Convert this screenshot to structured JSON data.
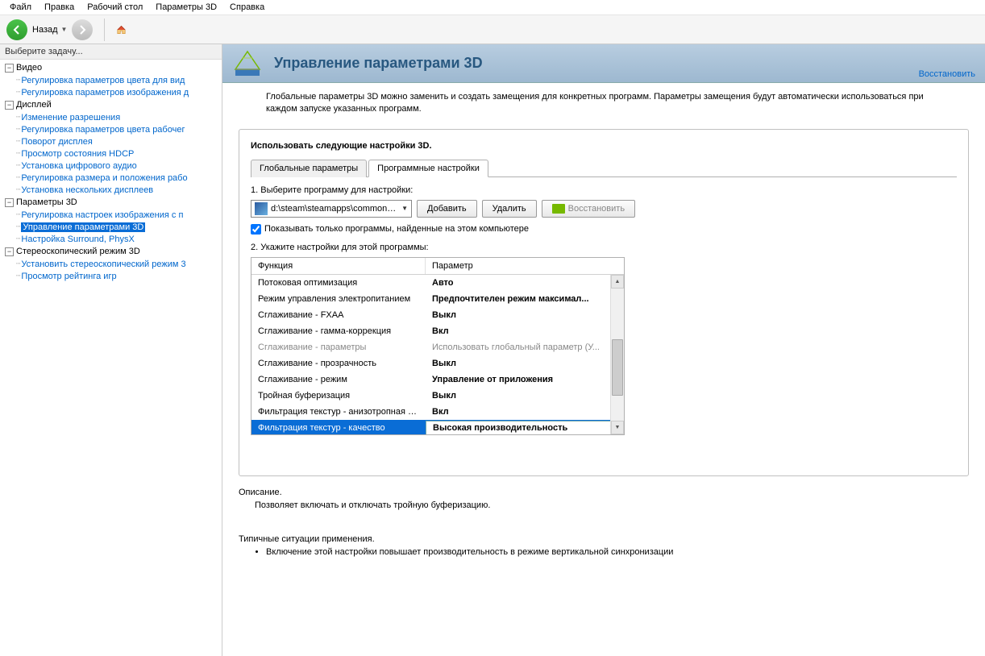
{
  "menubar": [
    "Файл",
    "Правка",
    "Рабочий стол",
    "Параметры 3D",
    "Справка"
  ],
  "toolbar": {
    "back": "Назад"
  },
  "sidebar": {
    "title": "Выберите задачу...",
    "groups": [
      {
        "label": "Видео",
        "items": [
          "Регулировка параметров цвета для вид",
          "Регулировка параметров изображения д"
        ]
      },
      {
        "label": "Дисплей",
        "items": [
          "Изменение разрешения",
          "Регулировка параметров цвета рабочег",
          "Поворот дисплея",
          "Просмотр состояния HDCP",
          "Установка цифрового аудио",
          "Регулировка размера и положения рабо",
          "Установка нескольких дисплеев"
        ]
      },
      {
        "label": "Параметры 3D",
        "items": [
          "Регулировка настроек изображения с п",
          "Управление параметрами 3D",
          "Настройка Surround, PhysX"
        ],
        "selected": 1
      },
      {
        "label": "Стереоскопический режим 3D",
        "items": [
          "Установить стереоскопический режим 3",
          "Просмотр рейтинга игр"
        ]
      }
    ]
  },
  "banner": {
    "title": "Управление параметрами 3D",
    "restore": "Восстановить"
  },
  "intro": "Глобальные параметры 3D можно заменить и создать замещения для конкретных программ. Параметры замещения будут автоматически использоваться при каждом запуске указанных программ.",
  "panel": {
    "heading": "Использовать следующие настройки 3D.",
    "tabs": [
      "Глобальные параметры",
      "Программные настройки"
    ],
    "active_tab": 1,
    "step1": "1. Выберите программу для настройки:",
    "program": "d:\\steam\\steamapps\\common\\r...",
    "btn_add": "Добавить",
    "btn_del": "Удалить",
    "btn_restore": "Восстановить",
    "checkbox": "Показывать только программы, найденные на этом компьютере",
    "step2": "2. Укажите настройки для этой программы:",
    "cols": {
      "func": "Функция",
      "param": "Параметр"
    },
    "rows": [
      {
        "func": "Потоковая оптимизация",
        "param": "Авто"
      },
      {
        "func": "Режим управления электропитанием",
        "param": "Предпочтителен режим максимал..."
      },
      {
        "func": "Сглаживание - FXAA",
        "param": "Выкл"
      },
      {
        "func": "Сглаживание - гамма-коррекция",
        "param": "Вкл"
      },
      {
        "func": "Сглаживание - параметры",
        "param": "Использовать глобальный параметр (У...",
        "disabled": true
      },
      {
        "func": "Сглаживание - прозрачность",
        "param": "Выкл"
      },
      {
        "func": "Сглаживание - режим",
        "param": "Управление от приложения"
      },
      {
        "func": "Тройная буферизация",
        "param": "Выкл"
      },
      {
        "func": "Фильтрация текстур - анизотропная оп...",
        "param": "Вкл"
      },
      {
        "func": "Фильтрация текстур - качество",
        "param": "Высокая производительность",
        "selected": true
      }
    ]
  },
  "description": {
    "heading": "Описание.",
    "body": "Позволяет включать и отключать тройную буферизацию."
  },
  "usage": {
    "heading": "Типичные ситуации применения.",
    "item": "Включение этой настройки повышает производительность в режиме вертикальной синхронизации"
  }
}
